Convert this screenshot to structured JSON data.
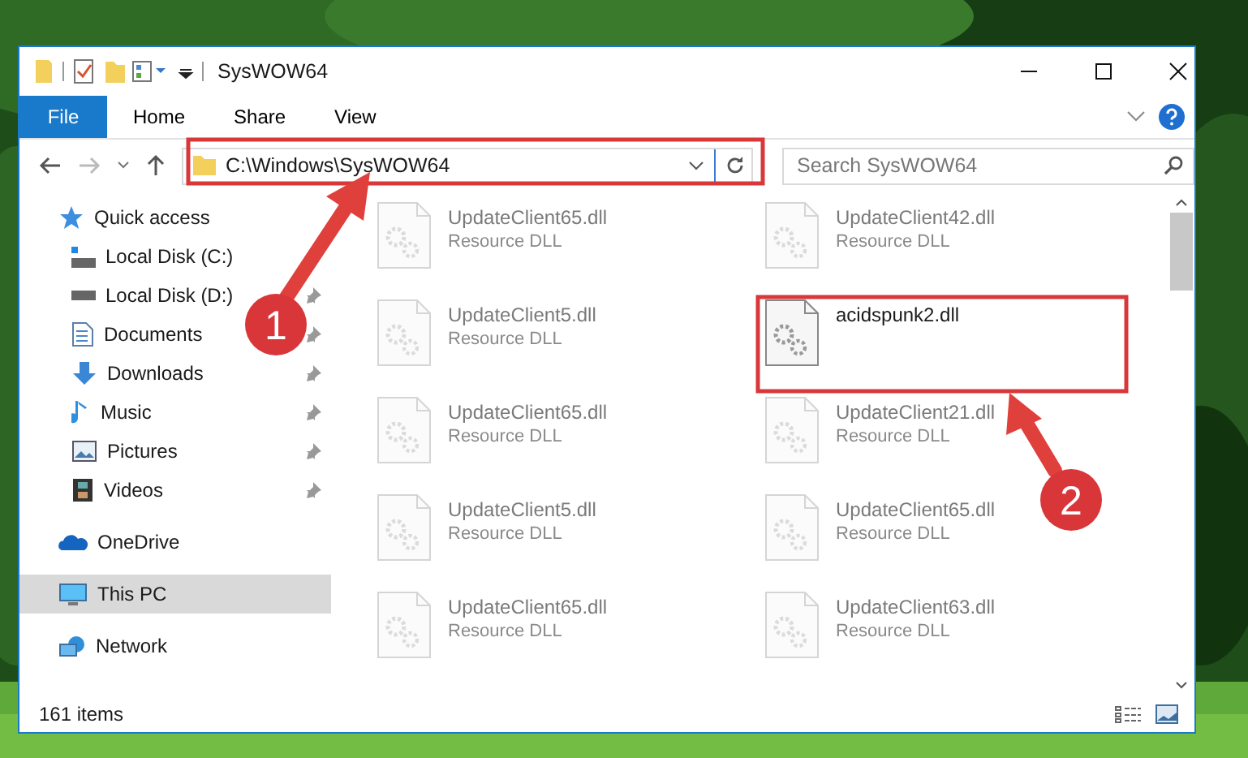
{
  "window": {
    "title": "SysWOW64"
  },
  "ribbon": {
    "tabs": [
      {
        "label": "File",
        "kind": "file"
      },
      {
        "label": "Home",
        "kind": "tab"
      },
      {
        "label": "Share",
        "kind": "tab"
      },
      {
        "label": "View",
        "kind": "tab"
      }
    ]
  },
  "address": {
    "path": "C:\\Windows\\SysWOW64"
  },
  "search": {
    "placeholder": "Search SysWOW64"
  },
  "sidebar": {
    "items": [
      {
        "label": "Quick access",
        "kind": "star",
        "selected": false,
        "children": [
          {
            "label": "Local Disk (C:)",
            "kind": "drive-c",
            "pinned": false,
            "selected": false
          },
          {
            "label": "Local Disk (D:)",
            "kind": "drive",
            "pinned": true,
            "selected": false
          },
          {
            "label": "Documents",
            "kind": "documents",
            "pinned": true,
            "selected": false
          },
          {
            "label": "Downloads",
            "kind": "downloads",
            "pinned": true,
            "selected": false
          },
          {
            "label": "Music",
            "kind": "music",
            "pinned": true,
            "selected": false
          },
          {
            "label": "Pictures",
            "kind": "pictures",
            "pinned": true,
            "selected": false
          },
          {
            "label": "Videos",
            "kind": "videos",
            "pinned": true,
            "selected": false
          }
        ]
      },
      {
        "label": "OneDrive",
        "kind": "cloud",
        "selected": false
      },
      {
        "label": "This PC",
        "kind": "pc",
        "selected": true
      },
      {
        "label": "Network",
        "kind": "network",
        "selected": false
      }
    ]
  },
  "files": [
    {
      "name": "UpdateClient65.dll",
      "type": "Resource DLL",
      "dimmed": true
    },
    {
      "name": "UpdateClient42.dll",
      "type": "Resource DLL",
      "dimmed": true
    },
    {
      "name": "UpdateClient5.dll",
      "type": "Resource DLL",
      "dimmed": true
    },
    {
      "name": "acidspunk2.dll",
      "dimmed": false
    },
    {
      "name": "UpdateClient65.dll",
      "type": "Resource DLL",
      "dimmed": true
    },
    {
      "name": "UpdateClient21.dll",
      "type": "Resource DLL",
      "dimmed": true
    },
    {
      "name": "UpdateClient5.dll",
      "type": "Resource DLL",
      "dimmed": true
    },
    {
      "name": "UpdateClient65.dll",
      "type": "Resource DLL",
      "dimmed": true
    },
    {
      "name": "UpdateClient65.dll",
      "type": "Resource DLL",
      "dimmed": true
    },
    {
      "name": "UpdateClient63.dll",
      "type": "Resource DLL",
      "dimmed": true
    }
  ],
  "status_bar": {
    "count": "161 items"
  },
  "annotations": [
    {
      "number": "1"
    },
    {
      "number": "2"
    }
  ]
}
